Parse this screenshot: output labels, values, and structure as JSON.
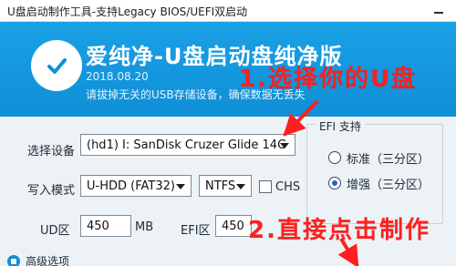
{
  "window": {
    "title": "U盘启动制作工具-支持Legacy BIOS/UEFI双启动",
    "minimize_icon": "minimize-icon"
  },
  "header": {
    "logo_icon": "check-circle-icon",
    "app_title": "爱纯净-U盘启动盘纯净版",
    "version": "2018.08.20",
    "hint": "请拔掉无关的USB存储设备，确保数据无丢失"
  },
  "annotations": {
    "step1": "1.选择你的U盘",
    "step2": "2.直接点击制作"
  },
  "form": {
    "select_device_label": "选择设备",
    "device_value": "(hd1) I: SanDisk Cruzer Glide 14G",
    "write_mode_label": "写入模式",
    "write_mode_value": "U-HDD (FAT32)",
    "filesystem_value": "NTFS",
    "chs_label": "CHS",
    "ud_label": "UD区",
    "ud_value": "450",
    "ud_unit": "MB",
    "efi_label": "EFI区",
    "efi_value": "450"
  },
  "efi_group": {
    "title": "EFI 支持",
    "option_standard": "标准（三分区）",
    "option_enhanced": "增强（三分区）"
  },
  "bottom": {
    "advanced_label": "高级选项"
  },
  "colors": {
    "accent_blue": "#0f8fd6",
    "annotation_red": "#ff1f1f"
  }
}
